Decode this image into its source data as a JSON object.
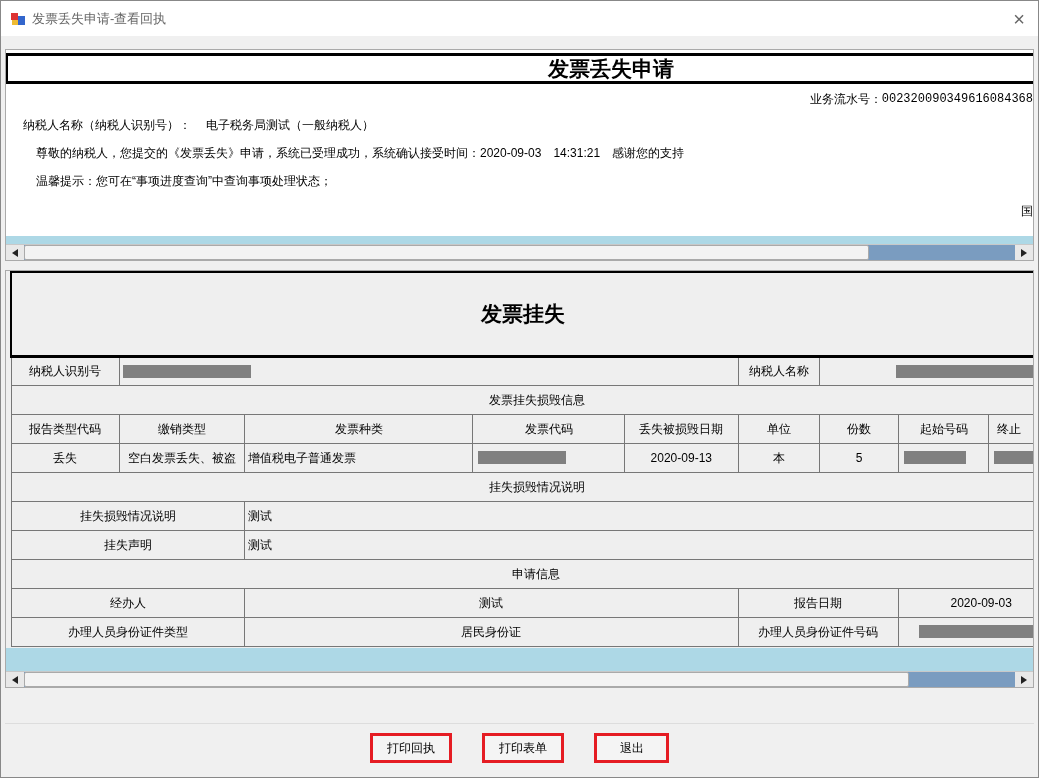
{
  "window": {
    "title": "发票丢失申请-查看回执",
    "close": "×"
  },
  "receipt": {
    "title": "发票丢失申请",
    "serial_label": "业务流水号：",
    "serial": "002320090349616084368",
    "lines": [
      "纳税人名称（纳税人识别号）：　 电子税务局测试（一般纳税人）",
      "尊敬的纳税人，您提交的《发票丢失》申请，系统已受理成功，系统确认接受时间：2020-09-03　14:31:21　感谢您的支持",
      "温馨提示：您可在“事项进度查询”中查询事项处理状态；"
    ],
    "edge_text": "国"
  },
  "form": {
    "title": "发票挂失",
    "taxpayer_id_label": "纳税人识别号",
    "taxpayer_id": {
      "redacted": true
    },
    "taxpayer_name_label": "纳税人名称",
    "taxpayer_name": {
      "redacted": true
    },
    "section_1": "发票挂失损毁信息",
    "columns": [
      "报告类型代码",
      "缴销类型",
      "发票种类",
      "发票代码",
      "丢失被损毁日期",
      "单位",
      "份数",
      "起始号码",
      "终止"
    ],
    "row": [
      {
        "text": "丢失",
        "redacted": false
      },
      {
        "text": "空白发票丢失、被盗",
        "redacted": false
      },
      {
        "text": "增值税电子普通发票",
        "redacted": false
      },
      {
        "redacted": true
      },
      {
        "text": "2020-09-13",
        "redacted": false
      },
      {
        "text": "本",
        "redacted": false
      },
      {
        "text": "5",
        "redacted": false
      },
      {
        "redacted": true
      },
      {
        "redacted": true
      }
    ],
    "section_2": "挂失损毁情况说明",
    "details": [
      {
        "label": "挂失损毁情况说明",
        "value": "测试"
      },
      {
        "label": "挂失声明",
        "value": "测试"
      }
    ],
    "section_3": "申请信息",
    "agent_label": "经办人",
    "agent": "测试",
    "date_label": "报告日期",
    "date": "2020-09-03",
    "id_type_label": "办理人员身份证件类型",
    "id_type": "居民身份证",
    "id_no_label": "办理人员身份证件号码",
    "id_no": {
      "redacted": true
    }
  },
  "buttons": [
    "打印回执",
    "打印表单",
    "退出"
  ]
}
